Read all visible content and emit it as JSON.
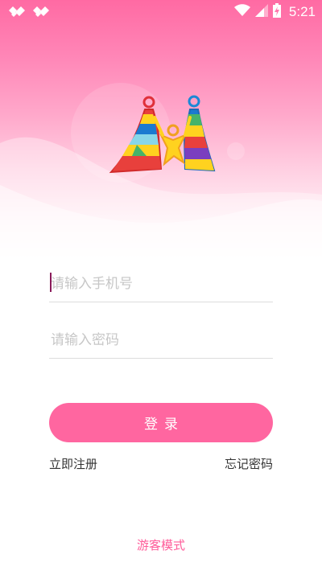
{
  "status_bar": {
    "time": "5:21",
    "icons": [
      "notification-icon",
      "notification-icon",
      "wifi-icon",
      "signal-icon",
      "battery-charging-icon"
    ]
  },
  "logo": {
    "icon": "family-m-logo-icon"
  },
  "login_form": {
    "phone_placeholder": "请输入手机号",
    "password_placeholder": "请输入密码",
    "login_label": "登录"
  },
  "links": {
    "register": "立即注册",
    "forgot_password": "忘记密码",
    "guest_mode": "游客模式"
  },
  "colors": {
    "accent": "#ff66a0",
    "header_top": "#ff6aa3",
    "guest_link": "#ff5c9a"
  }
}
